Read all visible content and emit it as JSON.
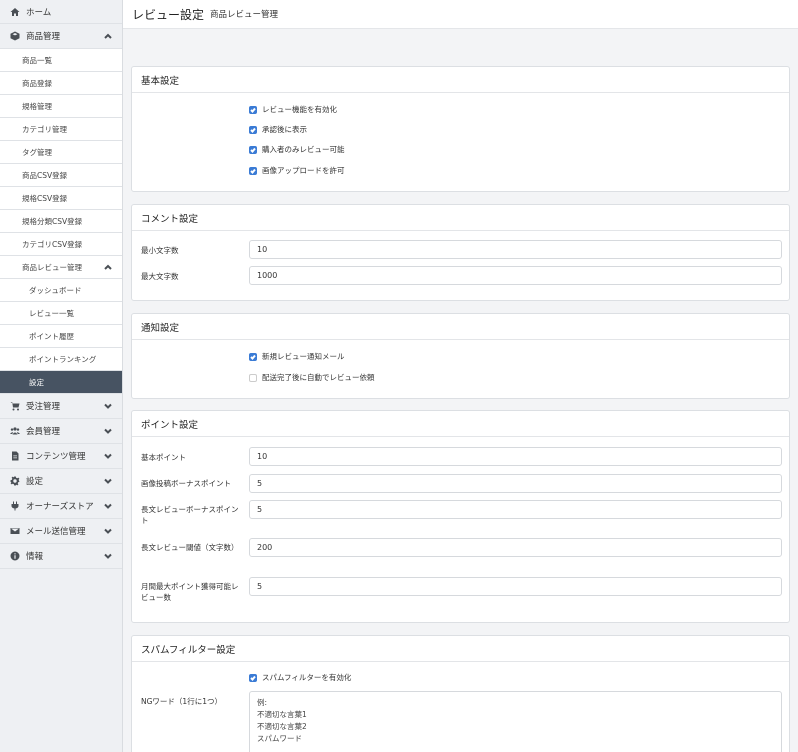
{
  "sidebar": {
    "home": "ホーム",
    "product_mgmt": "商品管理",
    "product_items": [
      "商品一覧",
      "商品登録",
      "規格管理",
      "カテゴリ管理",
      "タグ管理",
      "商品CSV登録",
      "規格CSV登録",
      "規格分類CSV登録",
      "カテゴリCSV登録"
    ],
    "review_mgmt": "商品レビュー管理",
    "review_items": [
      "ダッシュボード",
      "レビュー一覧",
      "ポイント履歴",
      "ポイントランキング",
      "設定"
    ],
    "order_mgmt": "受注管理",
    "member_mgmt": "会員管理",
    "content_mgmt": "コンテンツ管理",
    "settings": "設定",
    "owners_store": "オーナーズストア",
    "mail_mgmt": "メール送信管理",
    "info": "情報"
  },
  "header": {
    "title": "レビュー設定",
    "subtitle": "商品レビュー管理"
  },
  "basic": {
    "title": "基本設定",
    "checks": [
      {
        "label": "レビュー機能を有効化",
        "checked": true
      },
      {
        "label": "承認後に表示",
        "checked": true
      },
      {
        "label": "購入者のみレビュー可能",
        "checked": true
      },
      {
        "label": "画像アップロードを許可",
        "checked": true
      }
    ]
  },
  "comment": {
    "title": "コメント設定",
    "min_label": "最小文字数",
    "min_value": "10",
    "max_label": "最大文字数",
    "max_value": "1000"
  },
  "notify": {
    "title": "通知設定",
    "checks": [
      {
        "label": "新規レビュー通知メール",
        "checked": true
      },
      {
        "label": "配送完了後に自動でレビュー依頼",
        "checked": false
      }
    ]
  },
  "point": {
    "title": "ポイント設定",
    "fields": [
      {
        "label": "基本ポイント",
        "value": "10"
      },
      {
        "label": "画像投稿ボーナスポイント",
        "value": "5"
      },
      {
        "label": "長文レビューボーナスポイント",
        "value": "5"
      },
      {
        "label": "長文レビュー閾値（文字数）",
        "value": "200"
      },
      {
        "label": "月間最大ポイント獲得可能レビュー数",
        "value": "5"
      }
    ]
  },
  "spam": {
    "title": "スパムフィルター設定",
    "enable_label": "スパムフィルターを有効化",
    "ng_label": "NGワード（1行に1つ）",
    "ng_placeholder": [
      "例:",
      "不適切な言葉1",
      "不適切な言葉2",
      "スパムワード"
    ]
  }
}
